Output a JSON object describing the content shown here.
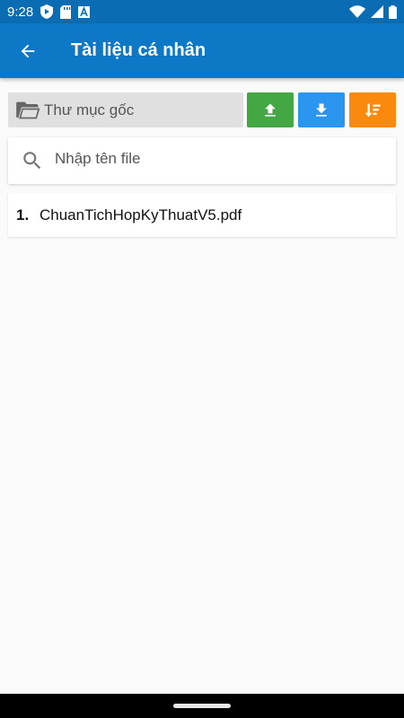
{
  "status_bar": {
    "time": "9:28",
    "left_icons": [
      "shield-play-icon",
      "sd-card-icon",
      "font-a-icon"
    ],
    "right_icons": [
      "wifi-icon",
      "signal-icon",
      "battery-icon"
    ]
  },
  "app_bar": {
    "title": "Tài liệu cá nhân",
    "back_icon": "arrow-back-icon",
    "color": "#0c78c6"
  },
  "toolbar": {
    "folder_label": "Thư mục gốc",
    "folder_icon": "folder-open-icon",
    "buttons": [
      {
        "name": "upload",
        "icon": "upload-icon",
        "color": "#43a844"
      },
      {
        "name": "download",
        "icon": "download-icon",
        "color": "#2b96ef"
      },
      {
        "name": "sort",
        "icon": "sort-icon",
        "color": "#f98a0d"
      }
    ]
  },
  "search": {
    "placeholder": "Nhập tên file",
    "value": "",
    "icon": "search-icon"
  },
  "files": [
    {
      "index": "1.",
      "name": "ChuanTichHopKyThuatV5.pdf"
    }
  ]
}
